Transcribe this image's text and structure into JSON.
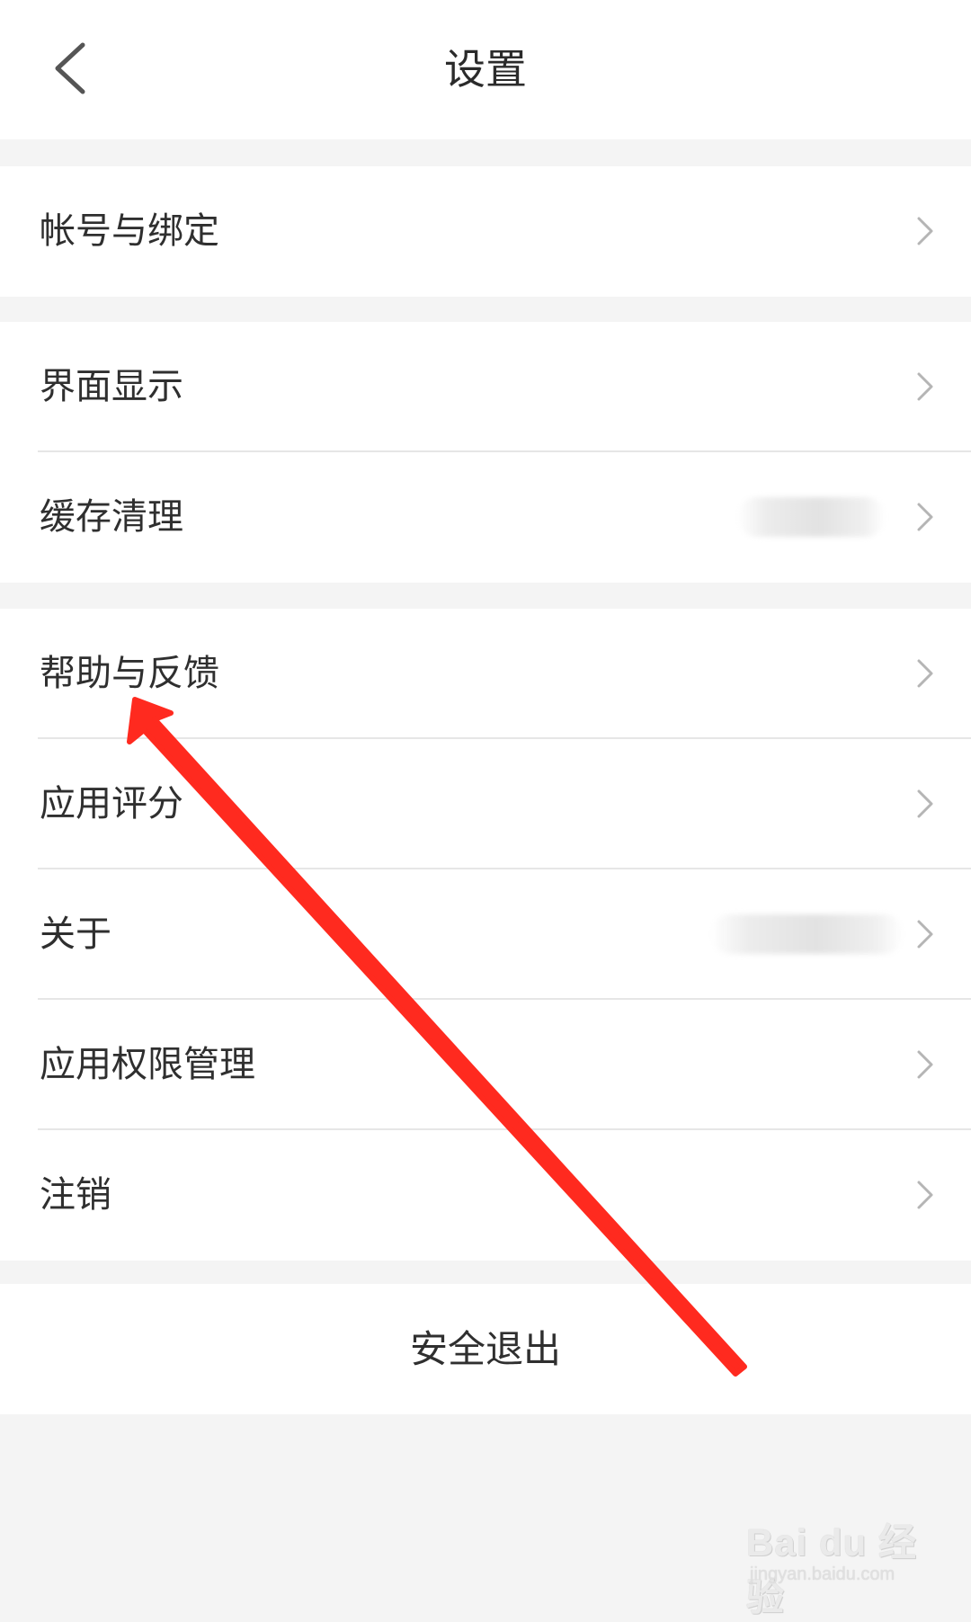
{
  "header": {
    "title": "设置",
    "back_icon": "chevron-left-icon"
  },
  "sections": [
    {
      "items": [
        {
          "label": "帐号与绑定",
          "icon": "chevron-right-icon"
        }
      ]
    },
    {
      "items": [
        {
          "label": "界面显示",
          "icon": "chevron-right-icon"
        },
        {
          "label": "缓存清理",
          "icon": "chevron-right-icon",
          "value_blurred": true
        }
      ]
    },
    {
      "items": [
        {
          "label": "帮助与反馈",
          "icon": "chevron-right-icon"
        },
        {
          "label": "应用评分",
          "icon": "chevron-right-icon"
        },
        {
          "label": "关于",
          "icon": "chevron-right-icon",
          "value_blurred": true
        },
        {
          "label": "应用权限管理",
          "icon": "chevron-right-icon"
        },
        {
          "label": "注销",
          "icon": "chevron-right-icon"
        }
      ]
    }
  ],
  "logout": {
    "label": "安全退出"
  },
  "annotation": {
    "type": "arrow",
    "color": "#ff2a1f",
    "points_to": "帮助与反馈"
  },
  "watermark": {
    "brand": "Bai du 经验",
    "url": "jingyan.baidu.com"
  },
  "colors": {
    "page_bg": "#f4f4f4",
    "card_bg": "#ffffff",
    "text": "#2f2f2f",
    "chevron": "#b5b5b5",
    "divider": "#e6e6e6"
  }
}
